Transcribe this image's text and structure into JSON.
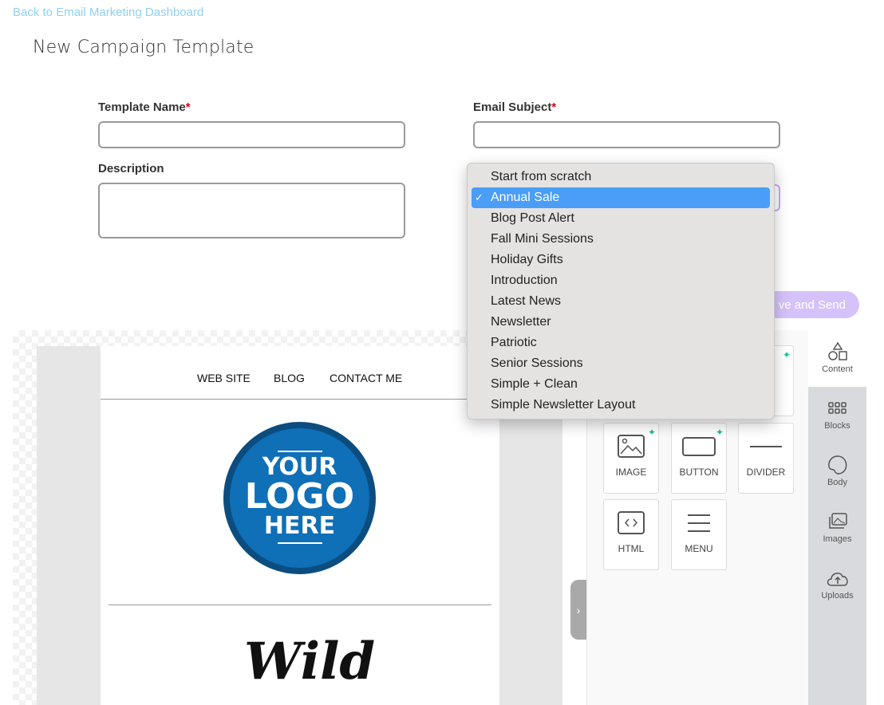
{
  "header": {
    "back_link": "Back to Email Marketing Dashboard",
    "title": "New Campaign Template"
  },
  "form": {
    "template_name_label": "Template Name",
    "email_subject_label": "Email Subject",
    "description_label": "Description",
    "required_mark": "*",
    "template_name_value": "",
    "email_subject_value": "",
    "description_value": ""
  },
  "template_select": {
    "selected": "Annual Sale",
    "options": [
      "Start from scratch",
      "Annual Sale",
      "Blog Post Alert",
      "Fall Mini Sessions",
      "Holiday Gifts",
      "Introduction",
      "Latest News",
      "Newsletter",
      "Patriotic",
      "Senior Sessions",
      "Simple + Clean",
      "Simple Newsletter Layout"
    ]
  },
  "save_button": "ve and Send",
  "email_preview": {
    "nav": [
      "WEB SITE",
      "BLOG",
      "CONTACT ME"
    ],
    "logo_lines": [
      "YOUR",
      "LOGO",
      "HERE"
    ],
    "script_title": "Wild"
  },
  "tools": [
    "IMAGE",
    "BUTTON",
    "DIVIDER",
    "HTML",
    "MENU"
  ],
  "side_tabs": [
    "Content",
    "Blocks",
    "Body",
    "Images",
    "Uploads"
  ],
  "colors": {
    "accent": "#d6c2fa",
    "selection": "#4a9ef8",
    "link": "#8fd0f5",
    "logo": "#0f6fb7"
  }
}
